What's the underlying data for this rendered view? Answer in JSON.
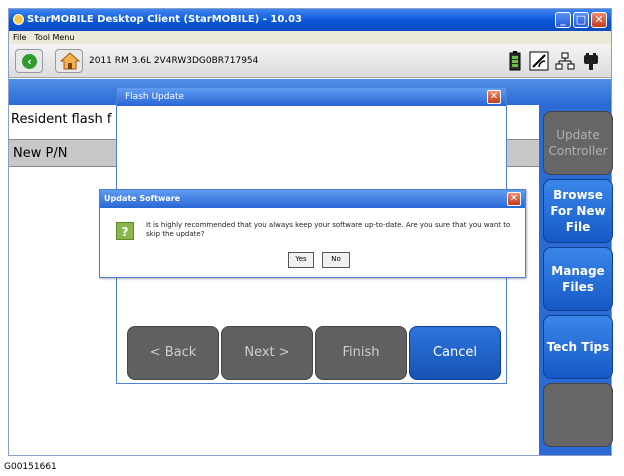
{
  "window": {
    "title": "StarMOBILE Desktop Client (StarMOBILE) - 10.03",
    "minimize": "_",
    "maximize": "□",
    "close": "✕"
  },
  "menu": {
    "items": [
      "File",
      "Tool Menu"
    ]
  },
  "toolbar": {
    "vehicle": "2011  RM  3.6L  2V4RW3DG0BR717954",
    "icons": [
      "battery-icon",
      "signal-icon",
      "network-icon",
      "vehicle-connector-icon"
    ]
  },
  "background": {
    "resident_label": "Resident flash f",
    "new_pn_label": "New P/N"
  },
  "sidenav": {
    "update_controller": "Update Controller",
    "browse_new_file": "Browse For New File",
    "manage_files": "Manage Files",
    "tech_tips": "Tech Tips"
  },
  "flash_dialog": {
    "title": "Flash Update",
    "close": "✕",
    "back": "< Back",
    "next": "Next >",
    "finish": "Finish",
    "cancel": "Cancel"
  },
  "update_dialog": {
    "title": "Update Software",
    "close": "✕",
    "icon": "?",
    "message": "It is highly recommended that you always keep your software up-to-date.  Are you sure that you want to skip the update?",
    "yes": "Yes",
    "no": "No"
  },
  "caption": "G00151661",
  "colors": {
    "title_blue": "#0a57d8",
    "nav_blue": "#2c6ad4",
    "disabled_gray": "#666666",
    "cancel_blue": "#1653b4",
    "question_green": "#88b64a"
  }
}
